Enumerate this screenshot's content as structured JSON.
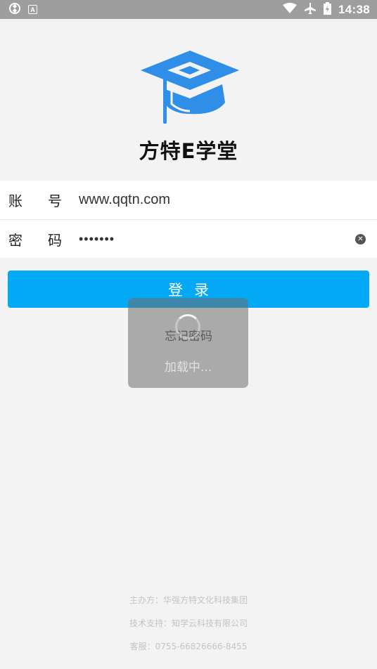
{
  "status_bar": {
    "time": "14:38",
    "left_icons": [
      "sync-icon",
      "a-badge-icon"
    ],
    "badge_letter": "A",
    "right_icons": [
      "wifi-icon",
      "airplane-icon",
      "battery-icon"
    ]
  },
  "app": {
    "title": "方特E学堂",
    "logo_color": "#2f8ee8"
  },
  "form": {
    "account_label_chars": [
      "账",
      "号"
    ],
    "account_value": "www.qqtn.com",
    "password_label_chars": [
      "密",
      "码"
    ],
    "password_value": "•••••••"
  },
  "actions": {
    "login_label": "登录",
    "forgot_label": "忘记密码"
  },
  "loading": {
    "text": "加载中..."
  },
  "footer": {
    "organizer": "主办方：华强方特文化科技集团",
    "tech_support": "技术支持：知学云科技有限公司",
    "service": "客服：0755-66826666-8455"
  },
  "colors": {
    "primary": "#03a9f4",
    "status_bar": "#9e9e9e",
    "background": "#f3f3f3"
  }
}
